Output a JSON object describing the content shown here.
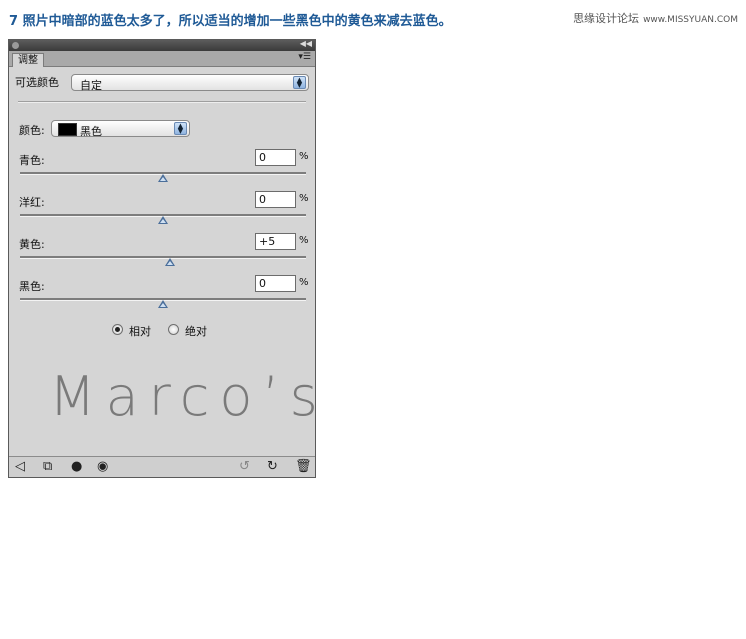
{
  "caption": "7  照片中暗部的蓝色太多了，所以适当的增加一些黑色中的黄色来减去蓝色。",
  "site": {
    "name": "思缘设计论坛",
    "url": "www.MISSYUAN.COM"
  },
  "panel": {
    "tab_label": "调整",
    "preset_label": "可选颜色",
    "preset_value": "自定",
    "colors_label": "颜色:",
    "colors_value": "黑色",
    "swatch_color": "#000000",
    "sliders": [
      {
        "label": "青色:",
        "value": "0",
        "unit": "%",
        "level": 0
      },
      {
        "label": "洋红:",
        "value": "0",
        "unit": "%",
        "level": 0
      },
      {
        "label": "黄色:",
        "value": "+5",
        "unit": "%",
        "level": 5
      },
      {
        "label": "黑色:",
        "value": "0",
        "unit": "%",
        "level": 0
      }
    ],
    "method": {
      "relative_label": "相对",
      "absolute_label": "绝对",
      "selected": "relative"
    },
    "watermark": "Marco’s"
  },
  "icons": {
    "footer_left": [
      "back-arrow-icon",
      "clip-layer-icon",
      "visibility-layer-icon",
      "eye-icon"
    ],
    "footer_right": [
      "view-previous-icon",
      "reset-icon",
      "trash-icon"
    ]
  },
  "colors": {
    "caption": "#1f5a96",
    "slider_thumb": "#4a6e9a"
  }
}
